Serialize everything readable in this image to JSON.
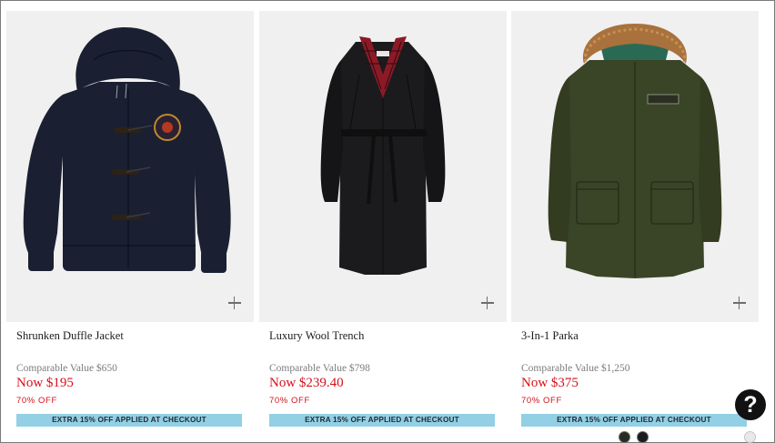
{
  "products": [
    {
      "name": "Shrunken Duffle Jacket",
      "comparable_value": "Comparable Value $650",
      "now_price": "Now $195",
      "discount": "70% OFF",
      "promo_banner": "EXTRA 15% OFF APPLIED AT CHECKOUT",
      "garment_color": "#1a2031"
    },
    {
      "name": "Luxury Wool Trench",
      "comparable_value": "Comparable Value $798",
      "now_price": "Now $239.40",
      "discount": "70% OFF",
      "promo_banner": "EXTRA 15% OFF APPLIED AT CHECKOUT",
      "garment_color": "#1b1b1d",
      "lining_color": "#8c1a26"
    },
    {
      "name": "3-In-1 Parka",
      "comparable_value": "Comparable Value $1,250",
      "now_price": "Now $375",
      "discount": "70% OFF",
      "promo_banner": "EXTRA 15% OFF APPLIED AT CHECKOUT",
      "garment_color": "#3a4426",
      "fur_color": "#a9713c",
      "hood_lining_color": "#2a6a55"
    }
  ],
  "quick_add_icon": "plus-icon",
  "help_button": {
    "label": "?",
    "icon": "question-mark-icon"
  },
  "color_swatches": [
    "#262b22",
    "#1c1c1c",
    "#e8e8e8"
  ],
  "colors": {
    "sale_red": "#d50f1a",
    "banner_blue": "#93cfe5",
    "tile_bg": "#f0f0f0"
  }
}
